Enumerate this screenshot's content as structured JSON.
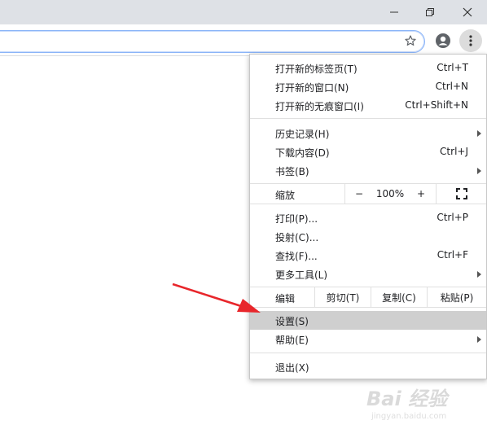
{
  "menu": {
    "items": {
      "new_tab": {
        "label": "打开新的标签页(T)",
        "shortcut": "Ctrl+T"
      },
      "new_window": {
        "label": "打开新的窗口(N)",
        "shortcut": "Ctrl+N"
      },
      "new_incognito": {
        "label": "打开新的无痕窗口(I)",
        "shortcut": "Ctrl+Shift+N"
      },
      "history": {
        "label": "历史记录(H)"
      },
      "downloads": {
        "label": "下载内容(D)",
        "shortcut": "Ctrl+J"
      },
      "bookmarks": {
        "label": "书签(B)"
      },
      "print": {
        "label": "打印(P)...",
        "shortcut": "Ctrl+P"
      },
      "cast": {
        "label": "投射(C)..."
      },
      "find": {
        "label": "查找(F)...",
        "shortcut": "Ctrl+F"
      },
      "more_tools": {
        "label": "更多工具(L)"
      },
      "settings": {
        "label": "设置(S)"
      },
      "help": {
        "label": "帮助(E)"
      },
      "exit": {
        "label": "退出(X)"
      }
    },
    "zoom": {
      "label": "缩放",
      "minus": "−",
      "value": "100%",
      "plus": "+"
    },
    "edit": {
      "label": "编辑",
      "cut": "剪切(T)",
      "copy": "复制(C)",
      "paste": "粘贴(P)"
    }
  },
  "highlighted_item": "settings",
  "colors": {
    "annotation_arrow": "#e8262b",
    "highlight": "#cfcfcf",
    "titlebar": "#dee1e6"
  },
  "watermark": {
    "line1": "Bai 经验",
    "line2": "jingyan.baidu.com"
  }
}
